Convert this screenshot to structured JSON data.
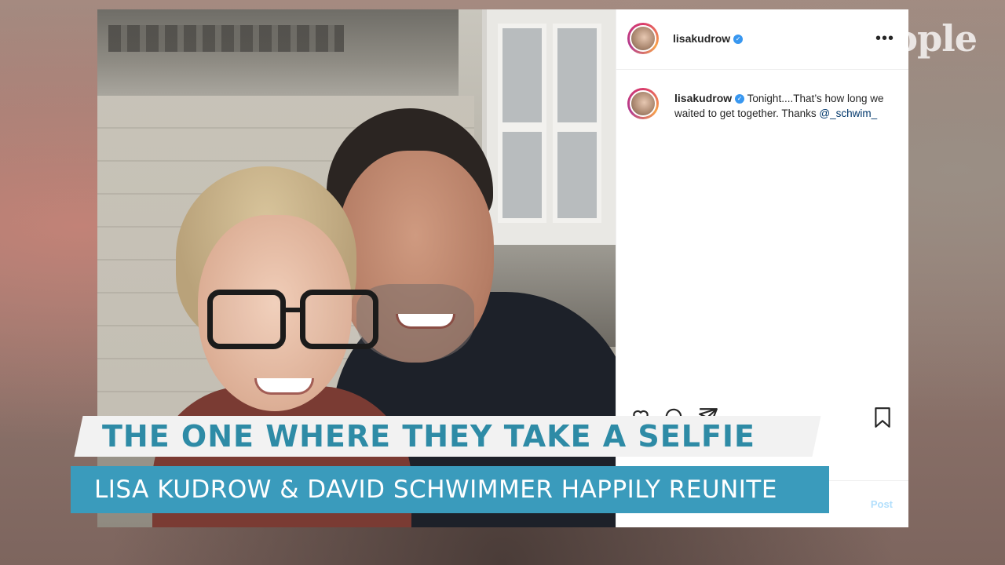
{
  "watermark": {
    "text": "ople"
  },
  "instagram_post": {
    "username": "lisakudrow",
    "verified_icon": "verified-badge-icon",
    "more_icon": "more-options-icon",
    "caption": {
      "username": "lisakudrow",
      "text": "Tonight....That’s how long we waited to get together. Thanks ",
      "mention": "@_schwim_"
    },
    "actions": {
      "like_icon": "heart-icon",
      "comment_icon": "comment-icon",
      "share_icon": "share-icon",
      "save_icon": "bookmark-icon"
    },
    "post_button_label": "Post"
  },
  "lower_third": {
    "headline": "THE ONE WHERE THEY TAKE A SELFIE",
    "subheadline": "LISA KUDROW & DAVID SCHWIMMER HAPPILY REUNITE"
  },
  "colors": {
    "headline_text": "#2e8ba6",
    "subheadline_bg": "#3a9bbc",
    "verified": "#3897f0"
  }
}
